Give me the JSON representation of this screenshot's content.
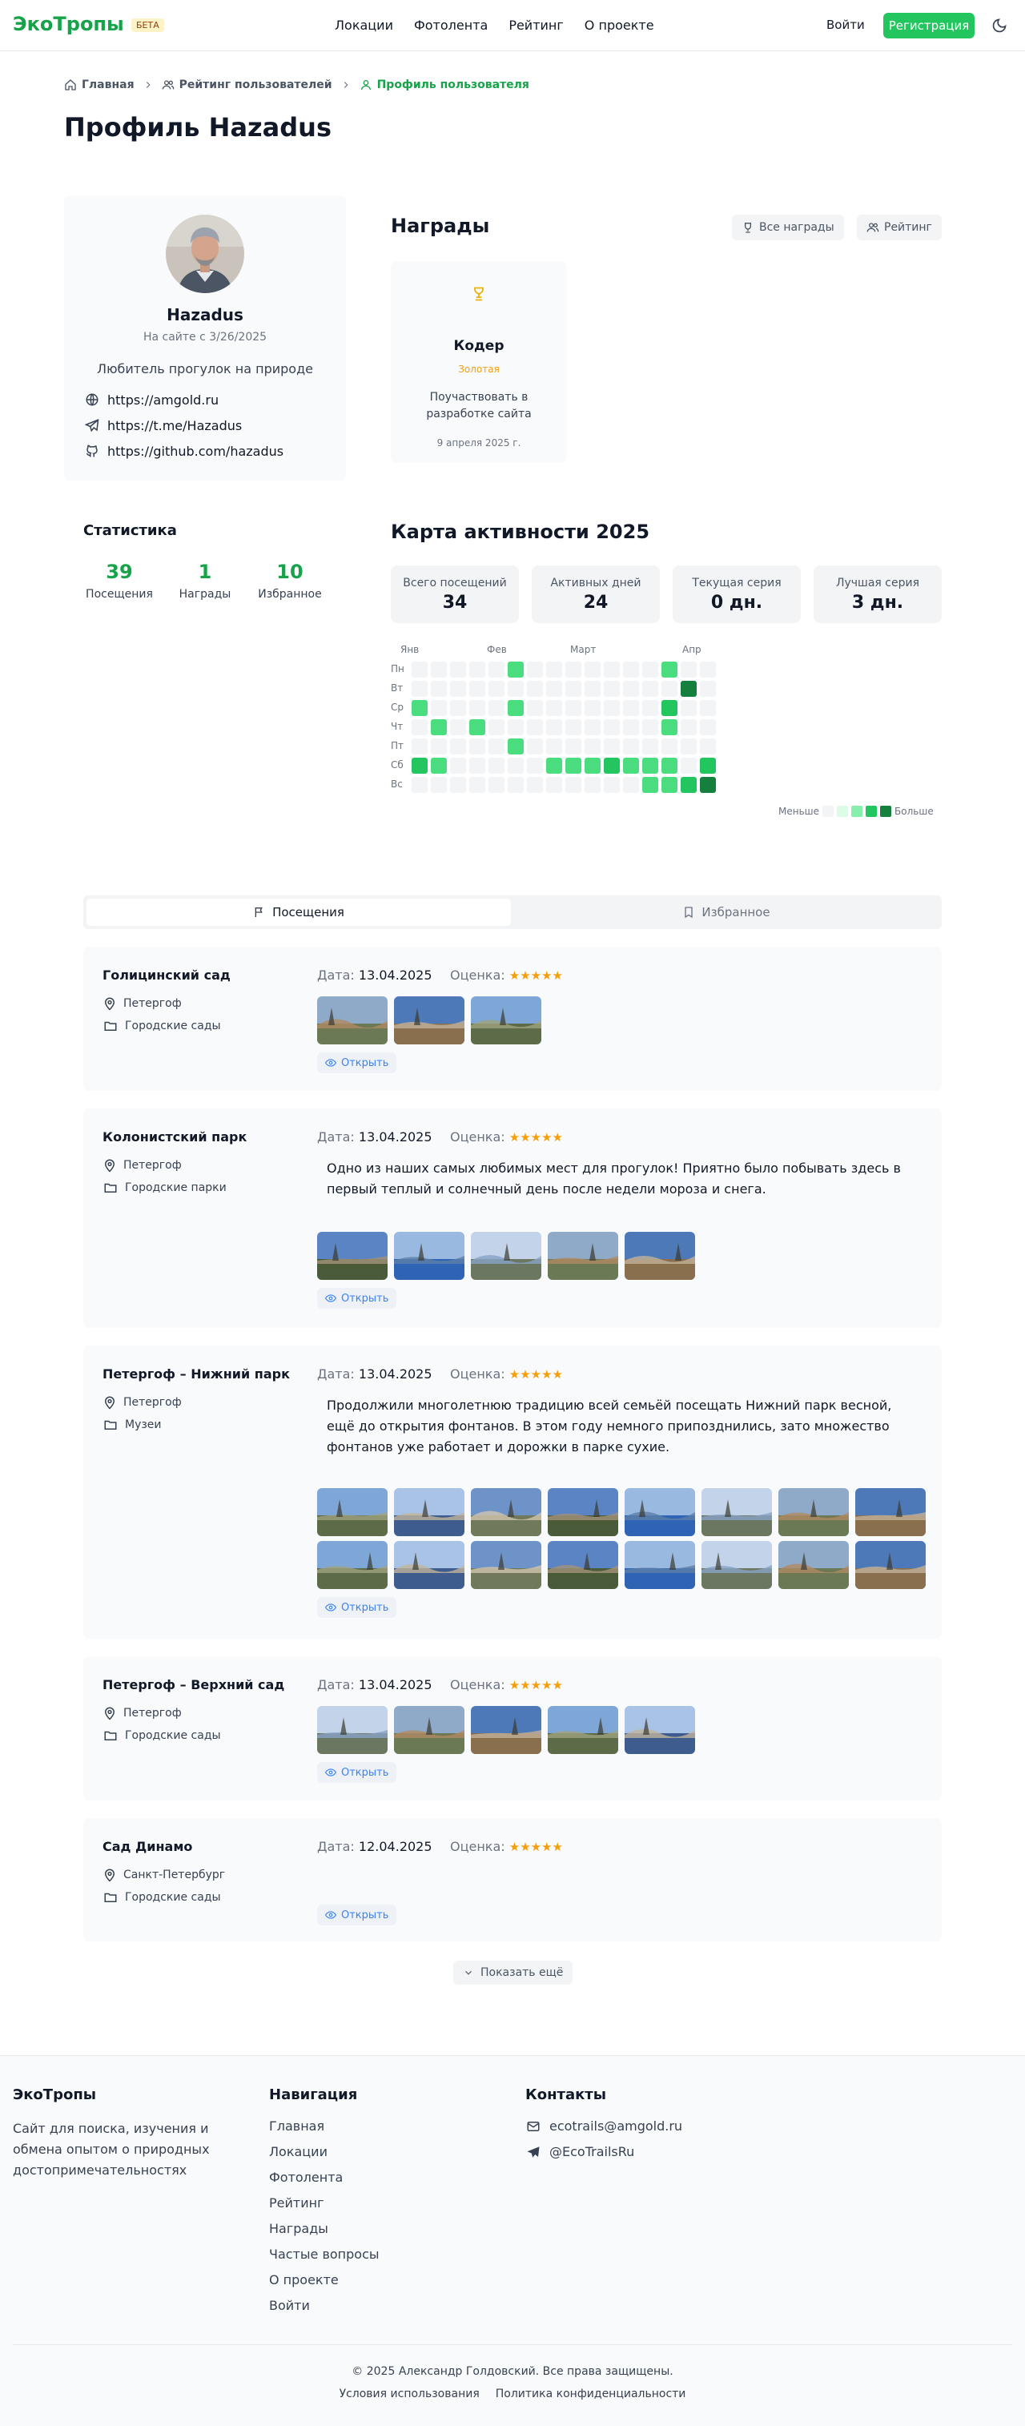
{
  "header": {
    "logo": "ЭкоТропы",
    "beta": "БЕТА",
    "nav": [
      "Локации",
      "Фотолента",
      "Рейтинг",
      "О проекте"
    ],
    "login": "Войти",
    "register": "Регистрация"
  },
  "breadcrumb": [
    "Главная",
    "Рейтинг пользователей",
    "Профиль пользователя"
  ],
  "page_title": "Профиль Hazadus",
  "profile": {
    "name": "Hazadus",
    "since": "На сайте с 3/26/2025",
    "bio": "Любитель прогулок на природе",
    "links": [
      {
        "icon": "globe-icon",
        "text": "https://amgold.ru"
      },
      {
        "icon": "telegram-icon",
        "text": "https://t.me/Hazadus"
      },
      {
        "icon": "github-icon",
        "text": "https://github.com/hazadus"
      }
    ]
  },
  "awards": {
    "title": "Награды",
    "all_button": "Все награды",
    "rating_button": "Рейтинг",
    "items": [
      {
        "name": "Кодер",
        "level": "Золотая",
        "description": "Поучаствовать в разработке сайта",
        "date": "9 апреля 2025 г."
      }
    ]
  },
  "stats": {
    "title": "Статистика",
    "items": [
      {
        "value": "39",
        "label": "Посещения"
      },
      {
        "value": "1",
        "label": "Награды"
      },
      {
        "value": "10",
        "label": "Избранное"
      }
    ]
  },
  "activity": {
    "title": "Карта активности 2025",
    "boxes": [
      {
        "label": "Всего посещений",
        "value": "34"
      },
      {
        "label": "Активных дней",
        "value": "24"
      },
      {
        "label": "Текущая серия",
        "value": "0 дн."
      },
      {
        "label": "Лучшая серия",
        "value": "3 дн."
      }
    ],
    "months": [
      "Янв",
      "Фев",
      "Март",
      "Апр"
    ],
    "days": [
      "Пн",
      "Вт",
      "Ср",
      "Чт",
      "Пт",
      "Сб",
      "Вс"
    ],
    "legend_less": "Меньше",
    "legend_more": "Больше",
    "colors": [
      "#f3f4f6",
      "#dcfce7",
      "#86efac",
      "#4ade80",
      "#22c55e",
      "#15803d"
    ],
    "grid": [
      [
        0,
        0,
        0,
        0,
        0,
        3,
        0,
        0,
        0,
        0,
        0,
        0,
        0,
        3,
        0,
        0
      ],
      [
        0,
        0,
        0,
        0,
        0,
        0,
        0,
        0,
        0,
        0,
        0,
        0,
        0,
        0,
        5,
        0
      ],
      [
        3,
        0,
        0,
        0,
        0,
        3,
        0,
        0,
        0,
        0,
        0,
        0,
        0,
        4,
        0,
        0
      ],
      [
        0,
        3,
        0,
        3,
        0,
        0,
        0,
        0,
        0,
        0,
        0,
        0,
        0,
        3,
        0,
        0
      ],
      [
        0,
        0,
        0,
        0,
        0,
        3,
        0,
        0,
        0,
        0,
        0,
        0,
        0,
        0,
        0,
        0
      ],
      [
        4,
        3,
        0,
        0,
        0,
        0,
        0,
        3,
        3,
        3,
        4,
        3,
        3,
        3,
        0,
        4
      ],
      [
        0,
        0,
        0,
        0,
        0,
        0,
        0,
        0,
        0,
        0,
        0,
        0,
        3,
        3,
        4,
        5
      ]
    ]
  },
  "tabs": {
    "visits": "Посещения",
    "favorites": "Избранное"
  },
  "visit_labels": {
    "date": "Дата:",
    "rating": "Оценка:",
    "open": "Открыть",
    "stars": "★★★★★"
  },
  "visits": [
    {
      "name": "Голицинский сад",
      "city": "Петергоф",
      "category": "Городские сады",
      "date": "13.04.2025",
      "text": "",
      "photos": 3
    },
    {
      "name": "Колонистский парк",
      "city": "Петергоф",
      "category": "Городские парки",
      "date": "13.04.2025",
      "text": "Одно из наших самых любимых мест для прогулок! Приятно было побывать здесь в первый теплый и солнечный день после недели мороза и снега.",
      "photos": 5
    },
    {
      "name": "Петергоф – Нижний парк",
      "city": "Петергоф",
      "category": "Музеи",
      "date": "13.04.2025",
      "text": "Продолжили многолетнюю традицию всей семьёй посещать Нижний парк весной, ещё до открытия фонтанов. В этом году немного припозднились, зато множество фонтанов уже работает и дорожки в парке сухие.",
      "photos": 16
    },
    {
      "name": "Петергоф – Верхний сад",
      "city": "Петергоф",
      "category": "Городские сады",
      "date": "13.04.2025",
      "text": "",
      "photos": 5
    },
    {
      "name": "Сад Динамо",
      "city": "Санкт-Петербург",
      "category": "Городские сады",
      "date": "12.04.2025",
      "text": "",
      "photos": 0
    }
  ],
  "show_more": "Показать ещё",
  "footer": {
    "brand": "ЭкоТропы",
    "description": "Сайт для поиска, изучения и обмена опытом о природных достопримечательностях",
    "nav_title": "Навигация",
    "nav": [
      "Главная",
      "Локации",
      "Фотолента",
      "Рейтинг",
      "Награды",
      "Частые вопросы",
      "О проекте",
      "Войти"
    ],
    "contacts_title": "Контакты",
    "email": "ecotrails@amgold.ru",
    "telegram": "@EcoTrailsRu",
    "copyright": "© 2025 Александр Голдовский. Все права защищены.",
    "terms": "Условия использования",
    "privacy": "Политика конфиденциальности"
  }
}
